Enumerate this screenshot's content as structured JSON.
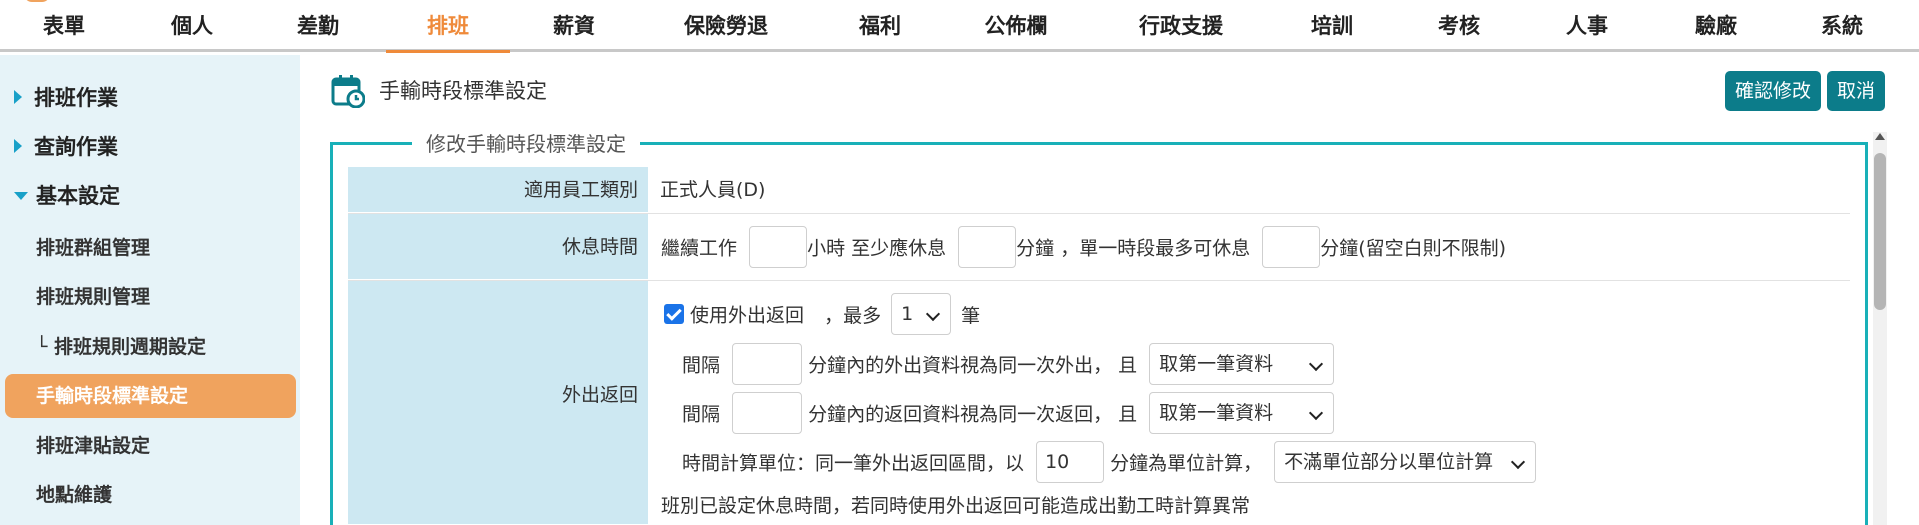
{
  "nav": {
    "items": [
      "表單",
      "個人",
      "差勤",
      "排班",
      "薪資",
      "保險勞退",
      "福利",
      "公佈欄",
      "行政支援",
      "培訓",
      "考核",
      "人事",
      "驗廠",
      "系統"
    ],
    "active_index": 3
  },
  "sidebar": {
    "sections": [
      {
        "label": "排班作業",
        "expanded": false
      },
      {
        "label": "查詢作業",
        "expanded": false
      },
      {
        "label": "基本設定",
        "expanded": true
      }
    ],
    "items": [
      {
        "label": "排班群組管理",
        "active": false
      },
      {
        "label": "排班規則管理",
        "active": false
      },
      {
        "label": "└ 排班規則週期設定",
        "active": false
      },
      {
        "label": "手輸時段標準設定",
        "active": true
      },
      {
        "label": "排班津貼設定",
        "active": false
      },
      {
        "label": "地點維護",
        "active": false
      }
    ]
  },
  "header": {
    "title": "手輸時段標準設定",
    "confirm_label": "確認修改",
    "cancel_label": "取消"
  },
  "form": {
    "legend": "修改手輸時段標準設定",
    "employee_type": {
      "label": "適用員工類別",
      "value": "正式人員(D)"
    },
    "rest": {
      "label": "休息時間",
      "t1": "繼續工作",
      "t2": "小時 至少應休息",
      "t3": "分鐘 ，單一時段最多可休息",
      "t4": "分鐘(留空白則不限制)",
      "hours_value": "",
      "min_rest_value": "",
      "max_rest_value": ""
    },
    "outing": {
      "label": "外出返回",
      "use_checked": true,
      "use_label": "使用外出返回",
      "max_prefix": "，最多",
      "max_value": "1",
      "max_suffix": "筆",
      "interval_label": "間隔",
      "out_same_text": "分鐘內的外出資料視為同一次外出， 且",
      "out_value": "",
      "out_select": "取第一筆資料",
      "return_same_text": "分鐘內的返回資料視為同一次返回， 且",
      "return_value": "",
      "return_select": "取第一筆資料",
      "unit_prefix": "時間計算單位：同一筆外出返回區間，以",
      "unit_value": "10",
      "unit_suffix": "分鐘為單位計算，",
      "unit_select": "不滿單位部分以單位計算",
      "warning": "班別已設定休息時間，若同時使用外出返回可能造成出勤工時計算異常"
    }
  },
  "colors": {
    "accent_orange": "#ef8a3a",
    "sidebar_active": "#f0a35e",
    "button_teal": "#0c7c8a",
    "panel_border": "#18b0b8",
    "label_bg": "#cde8f2",
    "sidebar_bg": "#e6f3f8",
    "warning_red": "#e02020"
  }
}
